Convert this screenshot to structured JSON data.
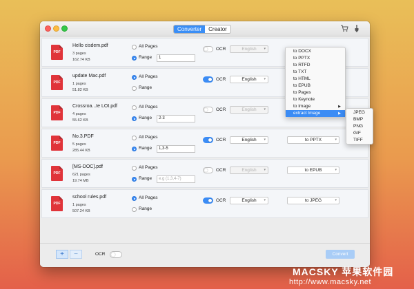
{
  "toolbar": {
    "tabs": [
      {
        "label": "Converter",
        "active": true
      },
      {
        "label": "Creator",
        "active": false
      }
    ],
    "cart_icon": "cart-icon",
    "info_icon": "brush-icon"
  },
  "options": {
    "all_pages": "All Pages",
    "range": "Range",
    "ocr": "OCR"
  },
  "files": [
    {
      "name": "Hello cisdem.pdf",
      "pages": "3 pages",
      "size": "162.74 KB",
      "range_selected": true,
      "range_value": "1",
      "ocr_on": false,
      "language": "English",
      "format": ""
    },
    {
      "name": "update Mac.pdf",
      "pages": "1 pages",
      "size": "51.82 KB",
      "range_selected": false,
      "range_value": "",
      "ocr_on": true,
      "language": "English",
      "format": ""
    },
    {
      "name": "Crossroa...te LOI.pdf",
      "pages": "4 pages",
      "size": "55.62 KB",
      "range_selected": true,
      "range_value": "2-3",
      "ocr_on": false,
      "language": "English",
      "format": ""
    },
    {
      "name": "No.3.PDF",
      "pages": "5 pages",
      "size": "285.44 KB",
      "range_selected": true,
      "range_value": "1,3-5",
      "ocr_on": true,
      "language": "English",
      "format": "to PPTX"
    },
    {
      "name": "[MS-DOC].pdf",
      "pages": "621 pages",
      "size": "19.74 MB",
      "range_selected": true,
      "range_value": "",
      "range_placeholder": "e.g (1,3,4-7)",
      "ocr_on": false,
      "language": "English",
      "format": "to EPUB"
    },
    {
      "name": "school rules.pdf",
      "pages": "1 pages",
      "size": "507.24 KB",
      "range_selected": false,
      "range_value": "",
      "ocr_on": true,
      "language": "English",
      "format": "to JPEG"
    }
  ],
  "format_menu": {
    "items": [
      "to DOCX",
      "to PPTX",
      "to RTFD",
      "to TXT",
      "to HTML",
      "to EPUB",
      "to Pages",
      "to Keynote",
      "to Image",
      "extract Image"
    ],
    "highlighted": "extract Image"
  },
  "submenu": {
    "items": [
      "JPEG",
      "BMP",
      "PNG",
      "GIF",
      "TIFF"
    ]
  },
  "bottom": {
    "add": "+",
    "remove": "−",
    "ocr_label": "OCR",
    "convert": "Convert"
  },
  "watermark": {
    "line1": "MACSKY 苹果软件园",
    "line2": "http://www.macsky.net"
  },
  "colors": {
    "accent": "#3b8cf5",
    "pdf_icon": "#e0343a"
  }
}
